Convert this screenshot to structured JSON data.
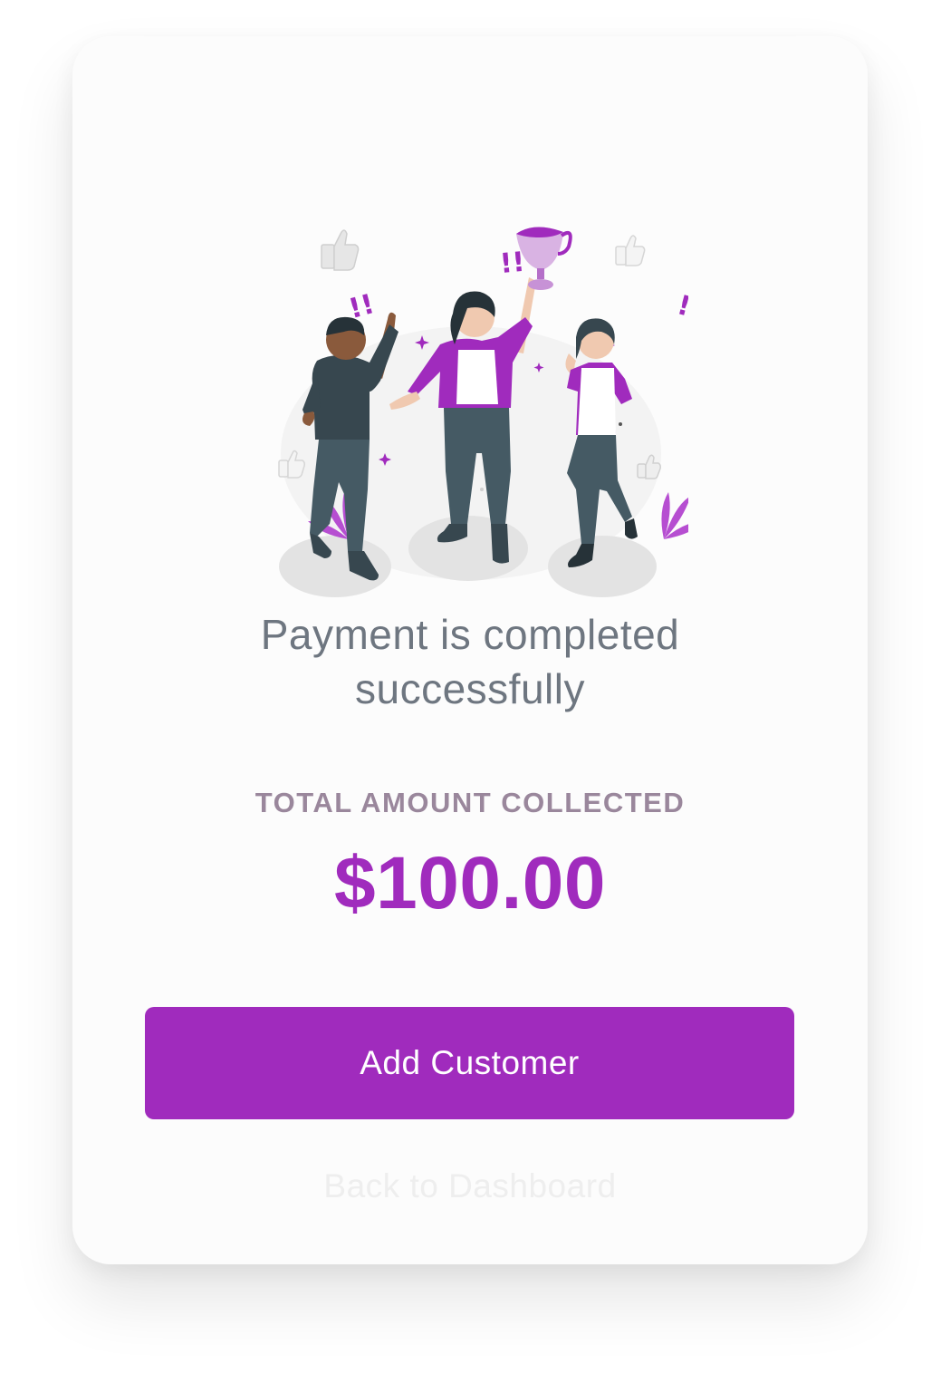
{
  "message": {
    "line1": "Payment is completed",
    "line2": "successfully"
  },
  "total": {
    "label": "TOTAL AMOUNT COLLECTED",
    "amount": "$100.00"
  },
  "actions": {
    "primary_label": "Add Customer",
    "secondary_label": "Back to Dashboard"
  },
  "illustration": {
    "name": "celebration-illustration",
    "exclaim_text": "!!"
  },
  "colors": {
    "accent": "#a02bbd",
    "message_text": "#6e7680",
    "label_text": "#9a879c",
    "card_bg": "#fcfcfc"
  }
}
